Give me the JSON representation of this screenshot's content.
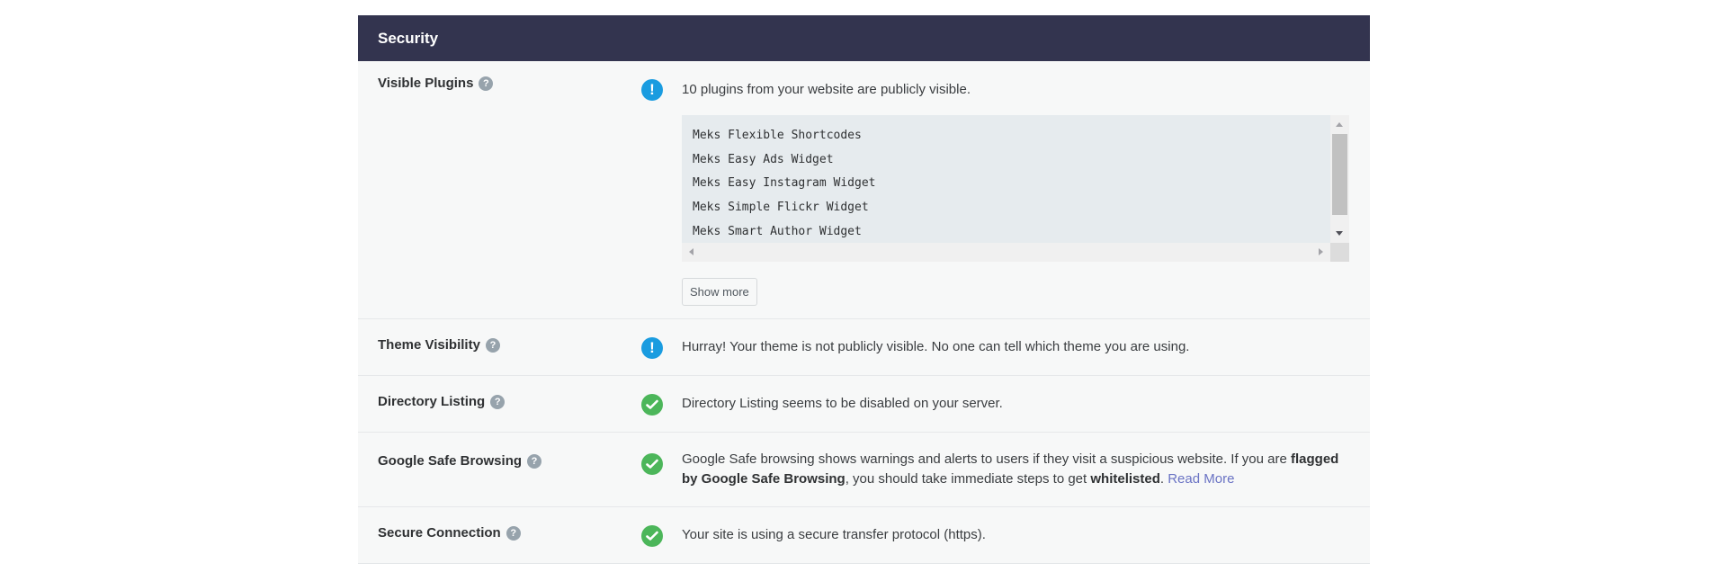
{
  "section": {
    "title": "Security"
  },
  "rows": [
    {
      "label": "Visible Plugins",
      "help": "?",
      "status": "warning",
      "message": "10 plugins from your website are publicly visible.",
      "plugins": [
        "Meks Flexible Shortcodes",
        "Meks Easy Ads Widget",
        "Meks Easy Instagram Widget",
        "Meks Simple Flickr Widget",
        "Meks Smart Author Widget"
      ],
      "show_more_label": "Show more"
    },
    {
      "label": "Theme Visibility",
      "help": "?",
      "status": "warning",
      "message": "Hurray! Your theme is not publicly visible. No one can tell which theme you are using."
    },
    {
      "label": "Directory Listing",
      "help": "?",
      "status": "ok",
      "message": "Directory Listing seems to be disabled on your server."
    },
    {
      "label": "Google Safe Browsing",
      "help": "?",
      "status": "ok",
      "message_parts": {
        "p1": "Google Safe browsing shows warnings and alerts to users if they visit a suspicious website. If you are ",
        "b1": "flagged by Google Safe Browsing",
        "p2": ", you should take immediate steps to get ",
        "b2": "whitelisted",
        "p3": ". ",
        "link": "Read More"
      }
    },
    {
      "label": "Secure Connection",
      "help": "?",
      "status": "ok",
      "message": "Your site is using a secure transfer protocol (https)."
    }
  ],
  "colors": {
    "header_bg": "#33344f",
    "warning": "#1a9ce0",
    "ok": "#4cb65a",
    "link": "#6a73c4"
  }
}
